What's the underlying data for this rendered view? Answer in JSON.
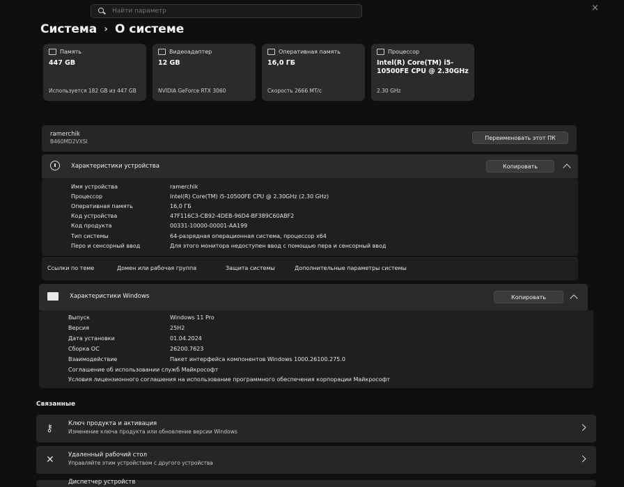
{
  "search": {
    "placeholder": "Найти параметр",
    "value": ""
  },
  "breadcrumb": {
    "parent": "Система",
    "separator": "›",
    "current": "О системе"
  },
  "cards": [
    {
      "title": "Память",
      "value": "447 GB",
      "footer": "Используется 182 GB из 447 GB"
    },
    {
      "title": "Видеоадаптер",
      "value": "12 GB",
      "footer": "NVIDIA GeForce RTX 3060"
    },
    {
      "title": "Оперативная память",
      "value": "16,0 ГБ",
      "footer": "Скорость 2666 МТ/с"
    },
    {
      "title": "Процессор",
      "value": "Intel(R) Core(TM) i5-10500FE CPU @ 2.30GHz",
      "footer": "2.30 GHz"
    }
  ],
  "device": {
    "name": "ramerchik",
    "model": "B460MD2VXSI",
    "rename_label": "Переименовать этот ПК"
  },
  "device_specs": {
    "title": "Характеристики устройства",
    "copy_label": "Копировать",
    "rows": [
      {
        "key": "Имя устройства",
        "value": "ramerchik"
      },
      {
        "key": "Процессор",
        "value": "Intel(R) Core(TM) i5-10500FE CPU @ 2.30GHz (2.30 GHz)"
      },
      {
        "key": "Оперативная память",
        "value": "16,0 ГБ"
      },
      {
        "key": "Код устройства",
        "value": "47F116C3-CB92-4DEB-96D4-BF389C60ABF2"
      },
      {
        "key": "Код продукта",
        "value": "00331-10000-00001-AA199"
      },
      {
        "key": "Тип системы",
        "value": "64-разрядная операционная система, процессор x64"
      },
      {
        "key": "Перо и сенсорный ввод",
        "value": "Для этого монитора недоступен ввод с помощью пера и сенсорный ввод"
      }
    ]
  },
  "related_links": {
    "label": "Ссылки по теме",
    "items": [
      "Домен или рабочая группа",
      "Защита системы",
      "Дополнительные параметры системы"
    ]
  },
  "windows_specs": {
    "title": "Характеристики Windows",
    "copy_label": "Копировать",
    "rows": [
      {
        "key": "Выпуск",
        "value": "Windows 11 Pro"
      },
      {
        "key": "Версия",
        "value": "25H2"
      },
      {
        "key": "Дата установки",
        "value": "01.04.2024"
      },
      {
        "key": "Сборка ОС",
        "value": "26200.7623"
      },
      {
        "key": "Взаимодействие",
        "value": "Пакет интерфейса компонентов Windows 1000.26100.275.0"
      }
    ],
    "links": [
      "Соглашение об использовании служб Майкрософт",
      "Условия лицензионного соглашения на использование программного обеспечения корпорации Майкрософт"
    ]
  },
  "related": {
    "title": "Связанные",
    "items": [
      {
        "title": "Ключ продукта и активация",
        "subtitle": "Изменение ключа продукта или обновление версии Windows"
      },
      {
        "title": "Удаленный рабочий стол",
        "subtitle": "Управляйте этим устройством с другого устройства"
      }
    ],
    "partial": "Диспетчер устройств"
  },
  "icons": {
    "close": "×",
    "key": "⚷",
    "remote": "✕"
  }
}
